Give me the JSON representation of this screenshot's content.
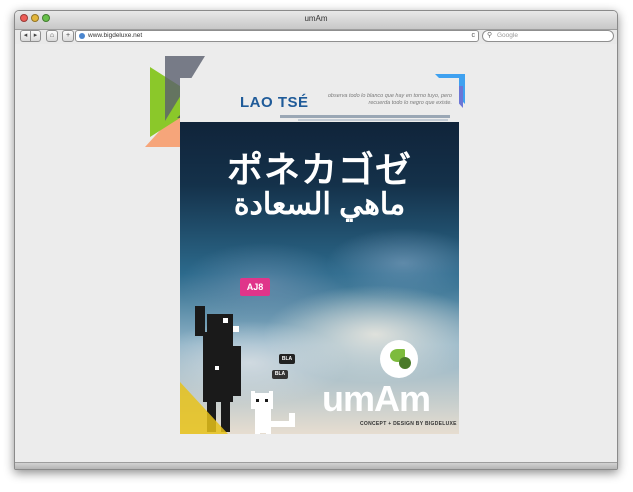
{
  "browser": {
    "title": "umAm",
    "url": "www.bigdeluxe.net",
    "search_placeholder": "Google",
    "back_icon": "◂",
    "forward_icon": "▸",
    "home_icon": "⌂",
    "add_icon": "+",
    "reload_icon": "c",
    "search_icon": "🔍"
  },
  "poster": {
    "header_title": "LAO TSÉ",
    "header_quote": "observa todo lo blanco que hay en torno tuyo, pero recuerda todo lo negro que existe.",
    "japanese_text": "ポネカゴゼ",
    "arabic_text": "ماهي السعادة",
    "bubble_pink": "AJ8",
    "bubble_small_1": "BLA",
    "bubble_small_2": "BLA",
    "brand": "umAm",
    "credits": "CONCEPT + DESIGN BY BIGDELUXE"
  },
  "colors": {
    "accent_blue": "#1f5b99",
    "pink": "#e0358a",
    "green": "#8bc82a"
  }
}
